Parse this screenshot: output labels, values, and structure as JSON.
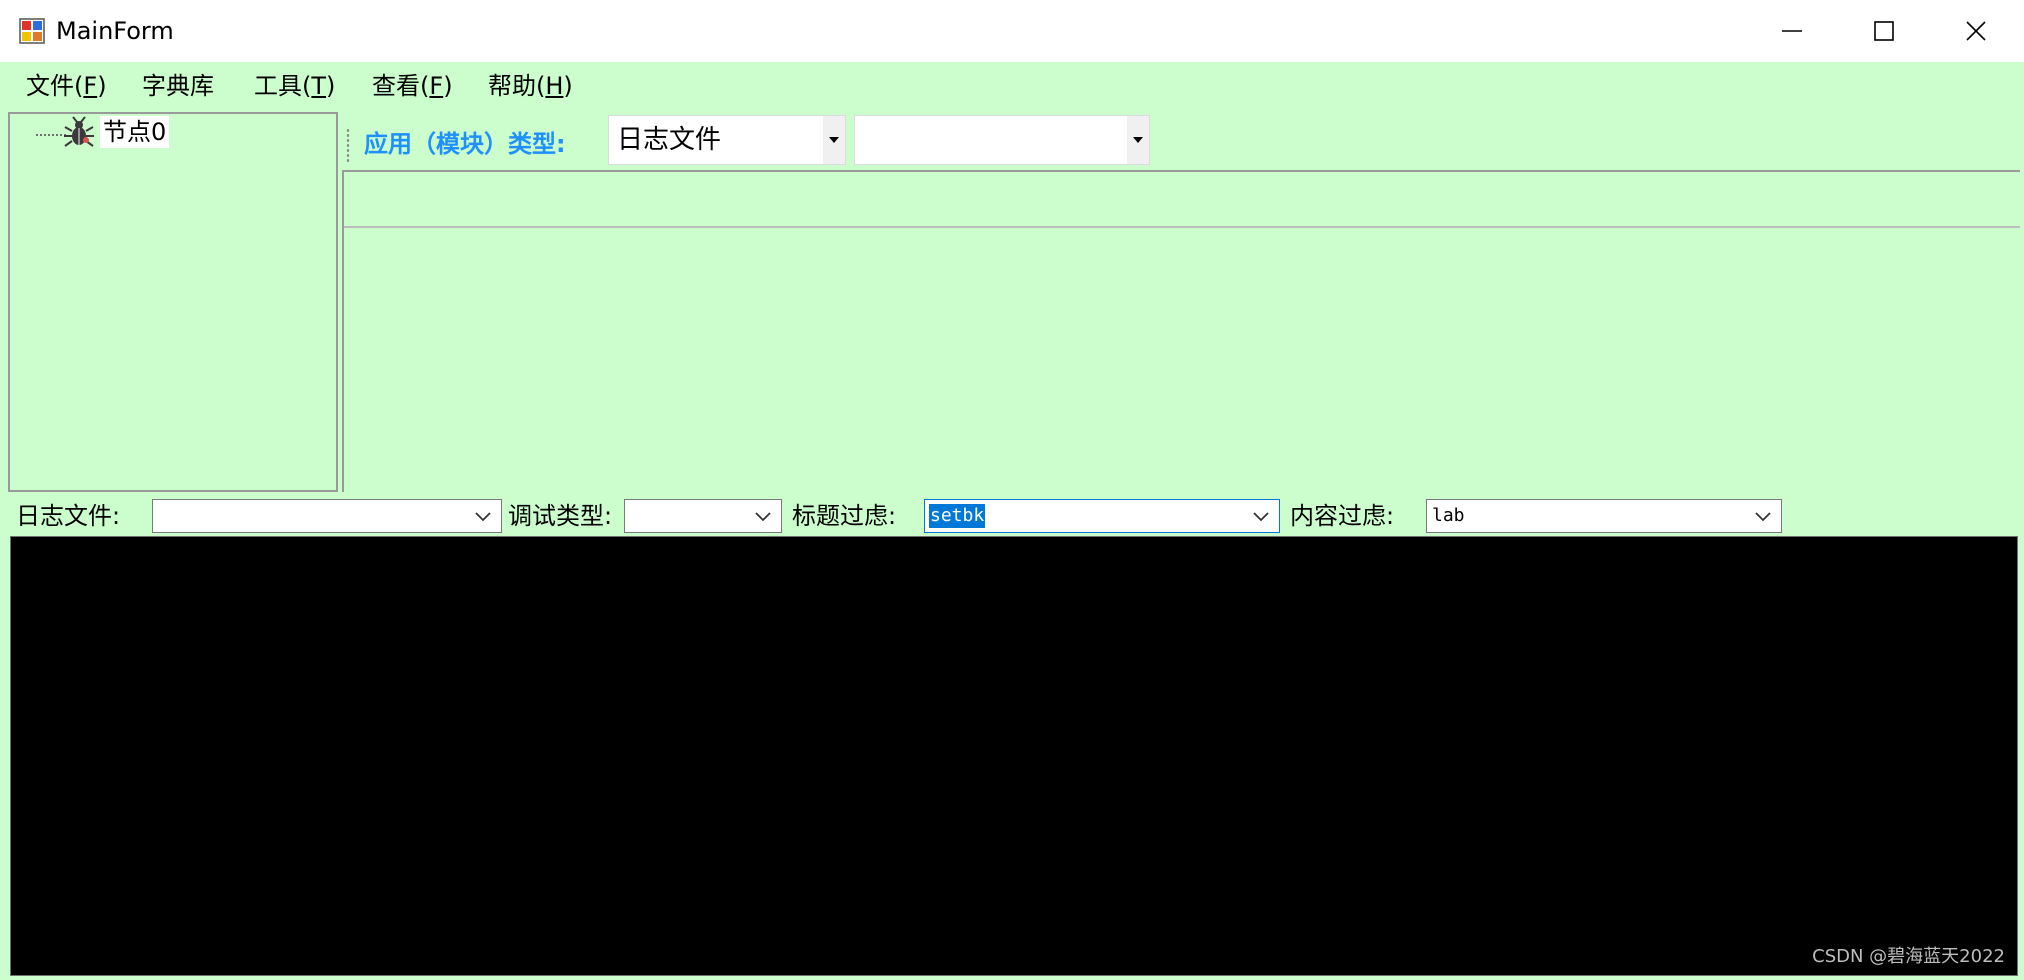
{
  "window": {
    "title": "MainForm",
    "controls": {
      "minimize": "minimize",
      "maximize": "maximize",
      "close": "close"
    }
  },
  "menu": {
    "items": [
      {
        "text": "文件(",
        "accel": "F",
        "end": ")"
      },
      {
        "text": "字典库",
        "accel": "",
        "end": ""
      },
      {
        "text": "工具(",
        "accel": "T",
        "end": ")"
      },
      {
        "text": "查看(",
        "accel": "F",
        "end": ")"
      },
      {
        "text": "帮助(",
        "accel": "H",
        "end": ")"
      }
    ]
  },
  "tree": {
    "nodes": [
      {
        "label": "节点0",
        "icon": "bug-icon"
      }
    ]
  },
  "toolstrip": {
    "label": "应用（模块）类型:",
    "combo1": {
      "value": "日志文件"
    },
    "combo2": {
      "value": ""
    }
  },
  "filters": {
    "log_file": {
      "label": "日志文件:",
      "value": ""
    },
    "debug_type": {
      "label": "调试类型:",
      "value": ""
    },
    "title_filter": {
      "label": "标题过虑:",
      "value": "setbk"
    },
    "content_filter": {
      "label": "内容过虑:",
      "value": "lab"
    }
  },
  "console": {
    "watermark": "CSDN @碧海蓝天2022"
  },
  "colors": {
    "background": "#ccfdcc",
    "toolstrip_label": "#1e90ff",
    "selection": "#0078d7",
    "console": "#000000"
  }
}
